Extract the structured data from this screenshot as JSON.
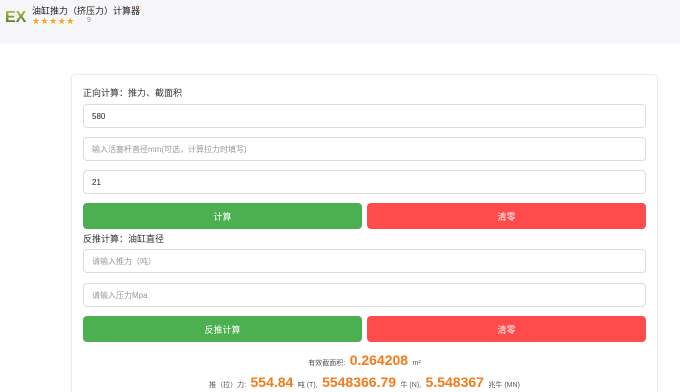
{
  "header": {
    "logo_text": "EX",
    "title": "油缸推力（挤压力）计算器",
    "stars": "★★★★★",
    "rating_count": "9"
  },
  "forward": {
    "title": "正向计算：推力、截面积",
    "bore_value": "580",
    "rod_placeholder": "输入活塞杆直径mm(可选，计算拉力时填写)",
    "pressure_value": "21",
    "calc_label": "计算",
    "clear_label": "清零"
  },
  "reverse": {
    "title": "反推计算：油缸直径",
    "thrust_placeholder": "请输入推力（吨）",
    "pressure_placeholder": "请输入压力Mpa",
    "calc_label": "反推计算",
    "clear_label": "清零"
  },
  "result": {
    "area_label": "有效截面积:",
    "area_value": "0.264208",
    "area_unit": "m²",
    "thrust_label": "推（拉）力:",
    "ton_value": "554.84",
    "ton_unit": "吨 (T),",
    "newton_value": "5548366.79",
    "newton_unit": "牛 (N),",
    "mn_value": "5.548367",
    "mn_unit": "兆牛 (MN)"
  },
  "colors": {
    "green": "#4caf50",
    "red": "#ff4b4b",
    "accent_orange": "#f27b1c",
    "star": "#ffa31a"
  }
}
